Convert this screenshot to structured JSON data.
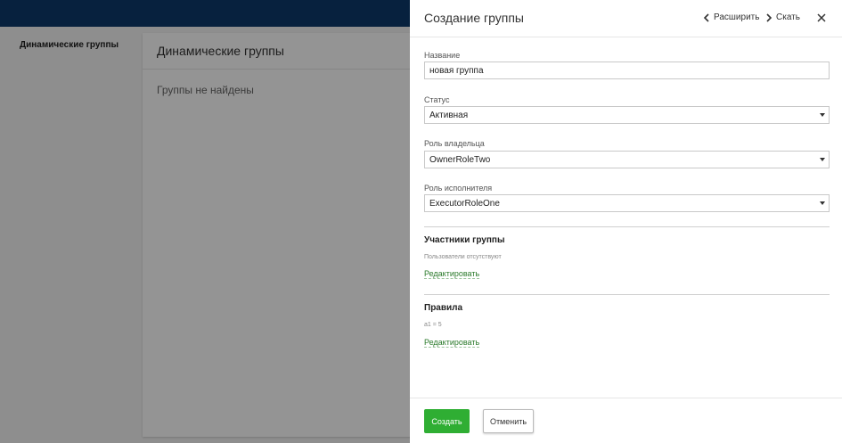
{
  "background": {
    "nav_item": "Динамические группы",
    "main_title": "Динамические группы",
    "empty_text": "Группы не найдены"
  },
  "panel": {
    "title": "Создание группы",
    "expand_label": "Расширить",
    "collapse_label": "Скать",
    "fields": {
      "name_label": "Название",
      "name_value": "новая группа",
      "status_label": "Статус",
      "status_value": "Активная",
      "owner_role_label": "Роль владельца",
      "owner_role_value": "OwnerRoleTwo",
      "executor_role_label": "Роль исполнителя",
      "executor_role_value": "ExecutorRoleOne"
    },
    "members": {
      "title": "Участники группы",
      "empty_text": "Пользователи отсутствуют",
      "edit_label": "Редактировать"
    },
    "rules": {
      "title": "Правила",
      "rule_text": "a1 = 5",
      "edit_label": "Редактировать"
    },
    "footer": {
      "create_label": "Создать",
      "cancel_label": "Отменить"
    }
  },
  "colors": {
    "topbar": "#0d3a6b",
    "primary_button": "#2fae33",
    "link": "#2a7a2a"
  }
}
